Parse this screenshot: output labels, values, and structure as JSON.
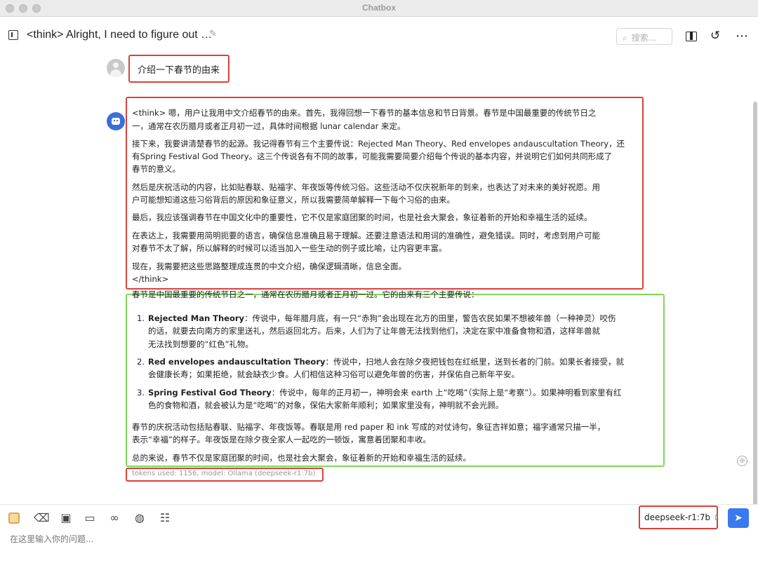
{
  "window": {
    "title": "Chatbox"
  },
  "header": {
    "session_title": "<think> Alright, I need to figure out …",
    "search_placeholder": "搜索..."
  },
  "user_message": "介绍一下春节的由来",
  "assistant": {
    "think_lines": [
      "<think> 嗯，用户让我用中文介绍春节的由来。首先，我得回想一下春节的基本信息和节日背景。春节是中国最重要的传统节日之",
      "一，通常在农历腊月或者正月初一过，具体时间根据 lunar calendar 来定。",
      "接下来，我要讲清楚春节的起源。我记得春节有三个主要传说：Rejected Man Theory、Red envelopes andauscultation Theory，还",
      "有Spring Festival God Theory。这三个传说各有不同的故事，可能我需要简要介绍每个传说的基本内容，并说明它们如何共同形成了",
      "春节的意义。",
      "然后是庆祝活动的内容，比如贴春联、贴福字、年夜饭等传统习俗。这些活动不仅庆祝新年的到来，也表达了对未来的美好祝愿。用",
      "户可能想知道这些习俗背后的原因和象征意义，所以我需要简单解释一下每个习俗的由来。",
      "最后，我应该强调春节在中国文化中的重要性，它不仅是家庭团聚的时间，也是社会大聚会，象征着新的开始和幸福生活的延续。",
      "在表达上，我需要用简明扼要的语言，确保信息准确且易于理解。还要注意语法和用词的准确性，避免错误。同时，考虑到用户可能",
      "对春节不太了解，所以解释的时候可以适当加入一些生动的例子或比喻，让内容更丰富。",
      "现在，我需要把这些思路整理成连贯的中文介绍，确保逻辑清晰，信息全面。",
      "</think>"
    ],
    "answer_intro": "春节是中国最重要的传统节日之一，通常在农历腊月或者正月初一过。它的由来有三个主要传说：",
    "list_items": [
      {
        "num": "1.",
        "term": "Rejected Man Theory",
        "lines": [
          "：传说中，每年腊月底，有一只“赤狗”会出现在北方的田里，警告农民如果不想被年兽（一种神灵）咬伤",
          "的话，就要去向南方的家里送礼，然后返回北方。后来，人们为了让年兽无法找到他们，决定在家中准备食物和酒，这样年兽就",
          "无法找到想要的“红色”礼物。"
        ]
      },
      {
        "num": "2.",
        "term": "Red envelopes andauscultation Theory",
        "lines": [
          "：传说中，扫地人会在除夕夜把钱包在红纸里，送到长者的门前。如果长者接受，就",
          "会健康长寿；如果拒绝，就会缺衣少食。人们相信这种习俗可以避免年兽的伤害，并保佑自己新年平安。"
        ]
      },
      {
        "num": "3.",
        "term": "Spring Festival God Theory",
        "lines": [
          "：传说中，每年的正月初一，神明会来 earth 上“吃喝”（实际上是“考察”）。如果神明看到家里有红",
          "色的食物和酒，就会被认为是“吃喝”的对象，保佑大家新年顺利；如果家里没有，神明就不会光顾。"
        ]
      }
    ],
    "closing_lines": [
      "春节的庆祝活动包括贴春联、贴福字、年夜饭等。春联是用 red paper 和 ink 写成的对仗诗句，象征吉祥如意；福字通常只描一半，",
      "表示“幸福”的样子。年夜饭是在除夕夜全家人一起吃的一顿饭，寓意着团聚和丰收。",
      "总的来说，春节不仅是家庭团聚的时间，也是社会大聚会，象征着新的开始和幸福生活的延续。"
    ],
    "tokens_info": "tokens used: 1156, model: Ollama (deepseek-r1:7b)"
  },
  "input": {
    "placeholder": "在这里输入你的问题...",
    "model_selected": "deepseek-r1:7b"
  },
  "icons": {
    "scroll_up": "⊕",
    "pencil": "✎",
    "search": "⌕",
    "history": "↺",
    "more": "⋯",
    "eraser": "⌫",
    "image": "▣",
    "folder": "▭",
    "link": "∞",
    "globe": "◍",
    "settings": "☷",
    "send": "➤",
    "select_arrows": "⇕"
  },
  "colors": {
    "highlight_red": "#d9413a",
    "highlight_green": "#7fd858",
    "send_blue": "#3b79f0",
    "bot_avatar": "#3b6fd8"
  }
}
